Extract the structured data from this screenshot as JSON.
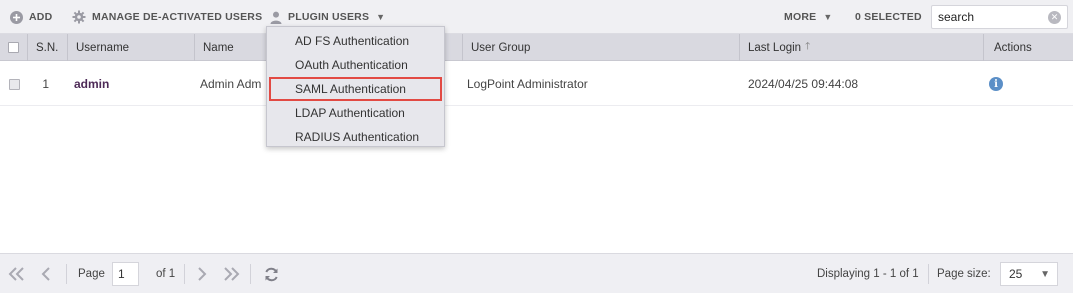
{
  "toolbar": {
    "add_label": "ADD",
    "manage_label": "MANAGE DE-ACTIVATED USERS",
    "plugin_label": "PLUGIN USERS",
    "more_label": "MORE",
    "selected_label": "0 SELECTED",
    "search_placeholder": "search"
  },
  "table": {
    "headers": {
      "sn": "S.N.",
      "username": "Username",
      "name": "Name",
      "user_group": "User Group",
      "last_login": "Last Login",
      "actions": "Actions"
    },
    "rows": [
      {
        "sn": "1",
        "username": "admin",
        "name": "Admin Adm",
        "user_group": "LogPoint Administrator",
        "last_login": "2024/04/25 09:44:08"
      }
    ]
  },
  "plugin_menu": {
    "items": [
      "AD FS Authentication",
      "OAuth Authentication",
      "SAML Authentication",
      "LDAP Authentication",
      "RADIUS Authentication"
    ],
    "highlighted_index": 2
  },
  "pagination": {
    "page_label": "Page",
    "page_value": "1",
    "of_label": "of 1",
    "displaying": "Displaying 1 - 1 of 1",
    "page_size_label": "Page size:",
    "page_size_value": "25"
  },
  "colors": {
    "username_link": "#4d2a57",
    "highlight_border": "#e24a43",
    "info_icon": "#5b8fc7"
  },
  "icons": {
    "add": "plus-circle-icon",
    "manage": "gear-icon",
    "plugin": "user-icon",
    "info": "info-icon",
    "first": "double-chevron-left-icon",
    "prev": "chevron-left-icon",
    "next": "chevron-right-icon",
    "last": "double-chevron-right-icon",
    "refresh": "refresh-icon"
  }
}
